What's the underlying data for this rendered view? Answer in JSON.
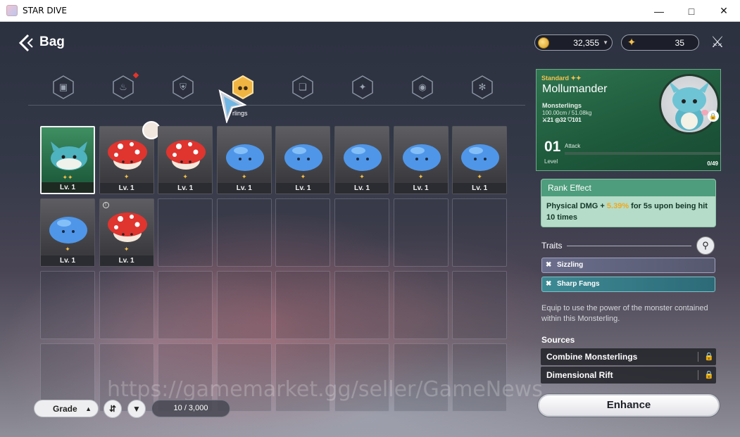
{
  "window": {
    "title": "STAR DIVE",
    "controls": [
      "minimize-icon",
      "maximize-icon",
      "close-icon"
    ]
  },
  "header": {
    "title": "Bag",
    "gold": "32,355",
    "stars": "35"
  },
  "tabs": {
    "items": [
      {
        "name": "tab-chest",
        "icon": "chest-icon"
      },
      {
        "name": "tab-food",
        "icon": "food-icon",
        "notification": true
      },
      {
        "name": "tab-armor",
        "icon": "armor-icon"
      },
      {
        "name": "tab-monsterlings",
        "icon": "monsterling-icon",
        "active": true
      },
      {
        "name": "tab-box",
        "icon": "box-icon"
      },
      {
        "name": "tab-star",
        "icon": "star-icon"
      },
      {
        "name": "tab-pouch",
        "icon": "pouch-icon"
      },
      {
        "name": "tab-compass",
        "icon": "compass-icon"
      }
    ],
    "active_label": "rlings"
  },
  "grid": {
    "slots": [
      {
        "monster": "teal-whale",
        "stars": "✦✦",
        "level": "Lv. 1",
        "selected": true
      },
      {
        "monster": "red-mushroom",
        "stars": "✦",
        "level": "Lv. 1",
        "badge": true
      },
      {
        "monster": "red-mushroom",
        "stars": "✦",
        "level": "Lv. 1"
      },
      {
        "monster": "blue-slime",
        "stars": "✦",
        "level": "Lv. 1"
      },
      {
        "monster": "blue-slime",
        "stars": "✦",
        "level": "Lv. 1"
      },
      {
        "monster": "blue-slime",
        "stars": "✦",
        "level": "Lv. 1"
      },
      {
        "monster": "blue-slime",
        "stars": "✦",
        "level": "Lv. 1"
      },
      {
        "monster": "blue-slime",
        "stars": "✦",
        "level": "Lv. 1"
      },
      {
        "monster": "blue-slime",
        "stars": "✦",
        "level": "Lv. 1"
      },
      {
        "monster": "red-mushroom",
        "stars": "✦",
        "level": "Lv. 1",
        "locked_marker": true
      }
    ],
    "total_slots": 32
  },
  "footer": {
    "sort_label": "Grade",
    "count": "10 / 3,000"
  },
  "watermark": "https://gamemarket.gg/seller/GameNews",
  "detail": {
    "grade": "Standard ✦✦",
    "name": "Mollumander",
    "type": "Monsterlings",
    "dimensions": "100.00cm / 51.08kg",
    "stats": "⚔21  ◎32  ⛉101",
    "level": "01",
    "level_label": "Level",
    "attack_label": "Attack",
    "exp": "0/49",
    "exp_progress": 0,
    "rank_effect_title": "Rank Effect",
    "rank_effect_prefix": "Physical DMG + ",
    "rank_effect_value": "5.39%",
    "rank_effect_suffix": " for 5s upon being hit 10 times",
    "traits_title": "Traits",
    "traits": [
      "Sizzling",
      "Sharp Fangs"
    ],
    "description": "Equip to use the power of the monster contained within this Monsterling.",
    "sources_title": "Sources",
    "sources": [
      "Combine Monsterlings",
      "Dimensional Rift"
    ],
    "enhance_label": "Enhance"
  },
  "colors": {
    "accent_gold": "#f4c24e",
    "card_green": "#1e5a3c",
    "rank_highlight": "#f0a81f"
  }
}
